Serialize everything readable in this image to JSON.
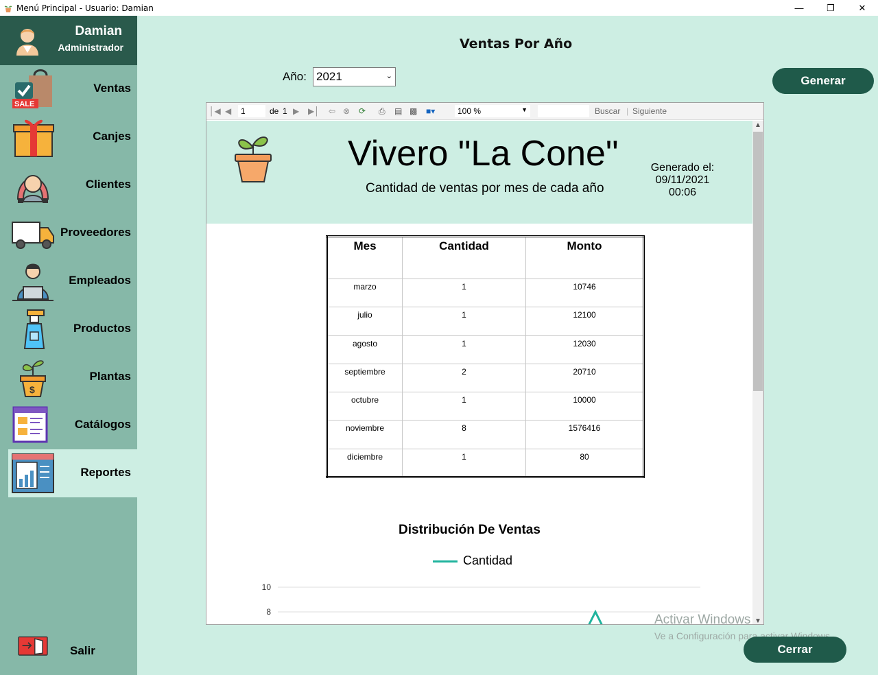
{
  "window": {
    "title": "Menú Principal - Usuario: Damian",
    "controls": [
      "minimize-icon",
      "restore-icon",
      "close-icon"
    ]
  },
  "sidebar": {
    "user_name": "Damian",
    "user_role": "Administrador",
    "items": [
      {
        "label": "Ventas",
        "icon": "shopping-bag-sale-icon"
      },
      {
        "label": "Canjes",
        "icon": "gift-box-icon"
      },
      {
        "label": "Clientes",
        "icon": "customer-icon"
      },
      {
        "label": "Proveedores",
        "icon": "delivery-truck-icon"
      },
      {
        "label": "Empleados",
        "icon": "employee-laptop-icon"
      },
      {
        "label": "Productos",
        "icon": "spray-bottle-icon"
      },
      {
        "label": "Plantas",
        "icon": "plant-pot-icon"
      },
      {
        "label": "Catálogos",
        "icon": "catalog-icon"
      },
      {
        "label": "Reportes",
        "icon": "report-chart-icon",
        "active": true
      }
    ],
    "exit_label": "Salir"
  },
  "main": {
    "page_title": "Ventas Por Año",
    "year_label": "Año:",
    "year_value": "2021",
    "generate_label": "Generar",
    "close_label": "Cerrar"
  },
  "viewer_toolbar": {
    "page_current": "1",
    "page_of": "de",
    "page_total": "1",
    "zoom": "100 %",
    "search_label": "Buscar",
    "next_label": "Siguiente"
  },
  "report": {
    "title": "Vivero \"La Cone\"",
    "subtitle": "Cantidad de ventas por mes de cada año",
    "generated_label": "Generado el:",
    "generated_date": "09/11/2021",
    "generated_time": "00:06",
    "columns": [
      "Mes",
      "Cantidad",
      "Monto"
    ],
    "rows": [
      [
        "marzo",
        "1",
        "10746"
      ],
      [
        "julio",
        "1",
        "12100"
      ],
      [
        "agosto",
        "1",
        "12030"
      ],
      [
        "septiembre",
        "2",
        "20710"
      ],
      [
        "octubre",
        "1",
        "10000"
      ],
      [
        "noviembre",
        "8",
        "1576416"
      ],
      [
        "diciembre",
        "1",
        "80"
      ]
    ],
    "chart_title": "Distribución De Ventas",
    "chart_legend": "Cantidad",
    "chart_ticks": [
      "10",
      "8"
    ],
    "colors": {
      "series": "#1fb39d"
    }
  },
  "watermark": {
    "line1": "Activar Windows",
    "line2": "Ve a Configuración para activar Windows."
  }
}
